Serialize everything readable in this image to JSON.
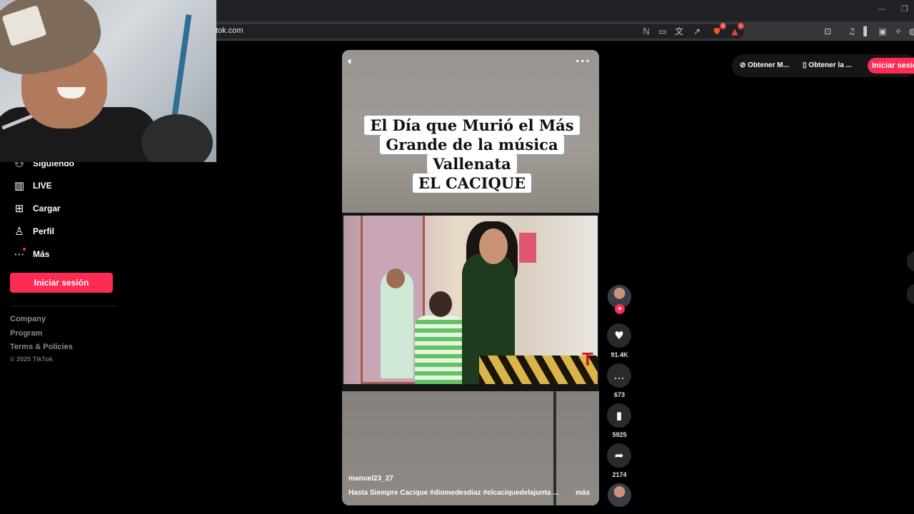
{
  "browser": {
    "url": "tiktok.com",
    "url_visible": "tok.com",
    "minimize": "—",
    "restore": "❐",
    "toolbar_icons": [
      "reader-mode-icon",
      "cast-icon",
      "translate-icon",
      "share-icon",
      "brave-shield-icon",
      "brave-rewards-icon",
      "tab-search-icon",
      "media-icon",
      "sidebar-icon",
      "wallet-icon",
      "leo-icon",
      "vpn-icon"
    ],
    "brave_badge": "5",
    "rewards_badge": "1"
  },
  "sidebar": {
    "items": [
      {
        "label": "Siguiendo",
        "icon": "following-icon"
      },
      {
        "label": "LIVE",
        "icon": "live-icon"
      },
      {
        "label": "Cargar",
        "icon": "upload-icon"
      },
      {
        "label": "Perfil",
        "icon": "profile-icon"
      },
      {
        "label": "Más",
        "icon": "more-dots-icon"
      }
    ],
    "login_label": "Iniciar sesión",
    "footer_links": [
      "Company",
      "Program",
      "Terms & Policies"
    ],
    "copyright": "© 2025 TikTok"
  },
  "video": {
    "caption_lines": [
      "El Día que Murió el Más",
      "Grande de la música",
      "Vallenata",
      "EL CACIQUE"
    ],
    "channel_logo": "T",
    "author": "manuel23_27",
    "description": "Hasta Siempre Cacique #diomedesdiaz  #elcaciquedelajunta  ...",
    "more_label": "más"
  },
  "actions": {
    "likes": "91.4K",
    "comments": "673",
    "saves": "5925",
    "shares": "2174"
  },
  "topbar": {
    "get_app_1": "Obtener M...",
    "get_app_2": "Obtener la ...",
    "login": "Iniciar sesión"
  },
  "colors": {
    "accent": "#fe2c55",
    "background": "#000000",
    "chrome": "#35363a"
  }
}
